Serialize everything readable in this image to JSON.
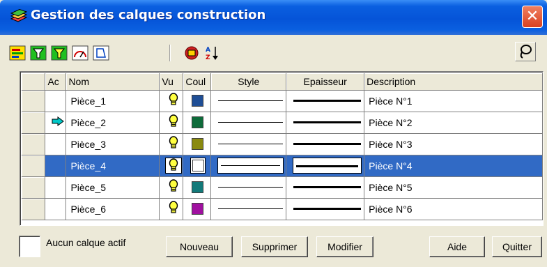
{
  "window": {
    "title": "Gestion des calques construction",
    "close_symbol": "✕"
  },
  "toolbar": {
    "icons": [
      "layer-edit-icon",
      "filter-icon",
      "filter-check-icon",
      "gauge-icon",
      "calque-icon",
      "layers-group-icon",
      "sort-az-icon"
    ],
    "right_icon": "lasso-icon"
  },
  "grid": {
    "columns": {
      "ac": "Ac",
      "nom": "Nom",
      "vu": "Vu",
      "coul": "Coul",
      "style": "Style",
      "epaisseur": "Epaisseur",
      "description": "Description"
    },
    "rows": [
      {
        "nom": "Pièce_1",
        "color": "#1f4e96",
        "description": "Pièce N°1",
        "active": false,
        "selected": false
      },
      {
        "nom": "Pièce_2",
        "color": "#0e6b3a",
        "description": "Pièce N°2",
        "active": true,
        "selected": false
      },
      {
        "nom": "Pièce_3",
        "color": "#8a8a10",
        "description": "Pièce N°3",
        "active": false,
        "selected": false
      },
      {
        "nom": "Pièce_4",
        "color": "#ffffff",
        "description": "Pièce N°4",
        "active": false,
        "selected": true
      },
      {
        "nom": "Pièce_5",
        "color": "#137a7a",
        "description": "Pièce N°5",
        "active": false,
        "selected": false
      },
      {
        "nom": "Pièce_6",
        "color": "#a010a0",
        "description": "Pièce N°6",
        "active": false,
        "selected": false
      }
    ]
  },
  "footer": {
    "checkbox_label": "Aucun calque actif",
    "buttons": {
      "nouveau": "Nouveau",
      "supprimer": "Supprimer",
      "modifier": "Modifier",
      "aide": "Aide",
      "quitter": "Quitter"
    }
  },
  "colors": {
    "selection": "#316ac5",
    "titlebar": "#0554d8",
    "active_arrow": "#00c8c8"
  }
}
